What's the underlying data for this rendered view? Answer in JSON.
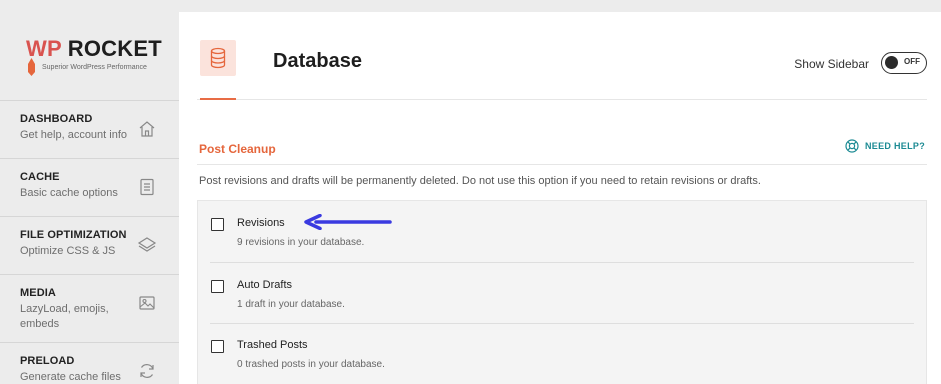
{
  "logo": {
    "title_wp": "WP",
    "title_rest": " ROCKET",
    "tagline": "Superior WordPress Performance"
  },
  "nav": [
    {
      "title": "DASHBOARD",
      "desc": "Get help, account info",
      "icon": "home-icon"
    },
    {
      "title": "CACHE",
      "desc": "Basic cache options",
      "icon": "document-icon"
    },
    {
      "title": "FILE OPTIMIZATION",
      "desc": "Optimize CSS & JS",
      "icon": "layers-icon"
    },
    {
      "title": "MEDIA",
      "desc": "LazyLoad, emojis, embeds",
      "icon": "image-icon"
    },
    {
      "title": "PRELOAD",
      "desc": "Generate cache files",
      "icon": "refresh-icon"
    }
  ],
  "header": {
    "title": "Database",
    "icon": "database-icon",
    "sidebar_toggle_label": "Show Sidebar",
    "toggle_state": "OFF"
  },
  "section": {
    "title": "Post Cleanup",
    "help_label": "NEED HELP?",
    "description": "Post revisions and drafts will be permanently deleted. Do not use this option if you need to retain revisions or drafts."
  },
  "options": [
    {
      "label": "Revisions",
      "desc": "9 revisions in your database.",
      "checked": false
    },
    {
      "label": "Auto Drafts",
      "desc": "1 draft in your database.",
      "checked": false
    },
    {
      "label": "Trashed Posts",
      "desc": "0 trashed posts in your database.",
      "checked": false
    }
  ],
  "colors": {
    "accent": "#e5663c",
    "help": "#1b8a93",
    "annotation_arrow": "#3a3ae0"
  }
}
